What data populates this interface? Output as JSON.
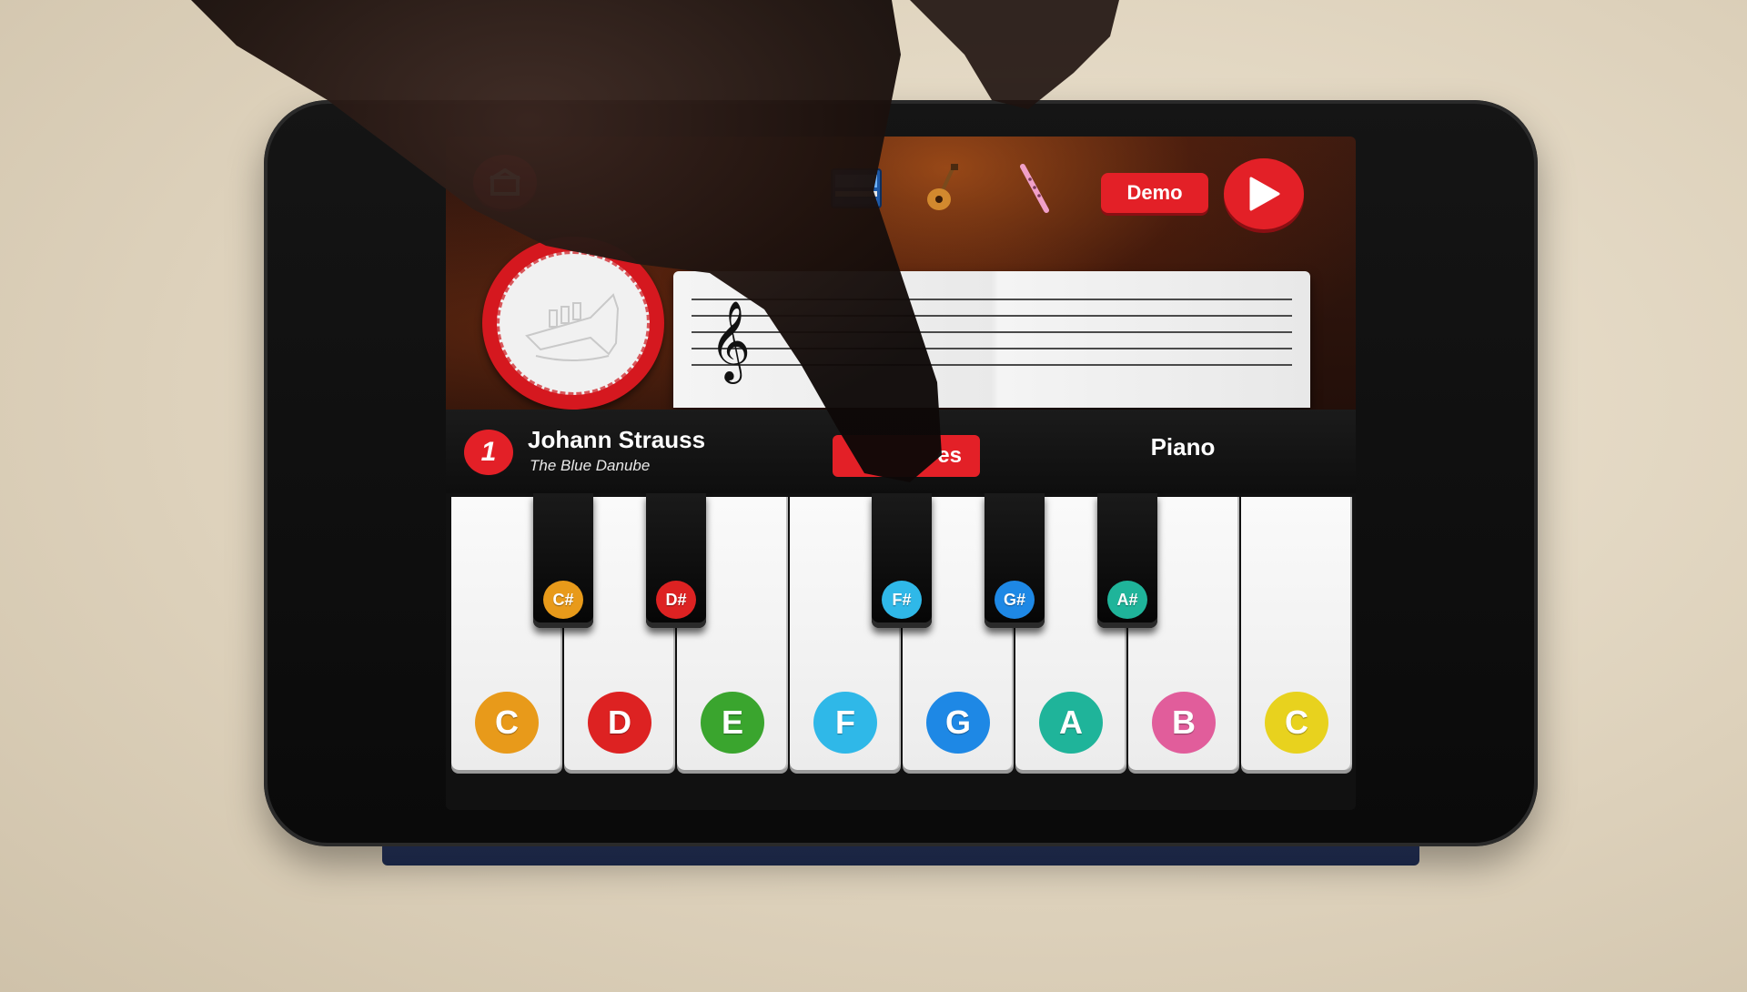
{
  "header": {
    "home_icon": "home-icon",
    "demo_label": "Demo",
    "instruments": [
      "piano-icon",
      "guitar-icon",
      "flute-icon"
    ],
    "play_icon": "play-icon"
  },
  "info_bar": {
    "song_number": "1",
    "composer": "Johann Strauss",
    "song_title": "The Blue Danube",
    "songs_button_label": "Songs",
    "songs_button_visible_text": "es",
    "instrument_label": "Piano"
  },
  "keyboard": {
    "white_keys": [
      {
        "note": "C",
        "color": "#e89a1a"
      },
      {
        "note": "D",
        "color": "#dd2222"
      },
      {
        "note": "E",
        "color": "#3aa52e"
      },
      {
        "note": "F",
        "color": "#2fb8e8"
      },
      {
        "note": "G",
        "color": "#1e88e5"
      },
      {
        "note": "A",
        "color": "#1fb49a"
      },
      {
        "note": "B",
        "color": "#e15d9b"
      },
      {
        "note": "C",
        "color": "#e8d21e"
      }
    ],
    "black_keys": [
      {
        "note": "C#",
        "color": "#e89a1a"
      },
      {
        "note": "D#",
        "color": "#dd2222"
      },
      {
        "note": "F#",
        "color": "#2fb8e8"
      },
      {
        "note": "G#",
        "color": "#1e88e5"
      },
      {
        "note": "A#",
        "color": "#1fb49a"
      }
    ]
  },
  "colors": {
    "accent": "#e32027",
    "background": "#111111"
  }
}
